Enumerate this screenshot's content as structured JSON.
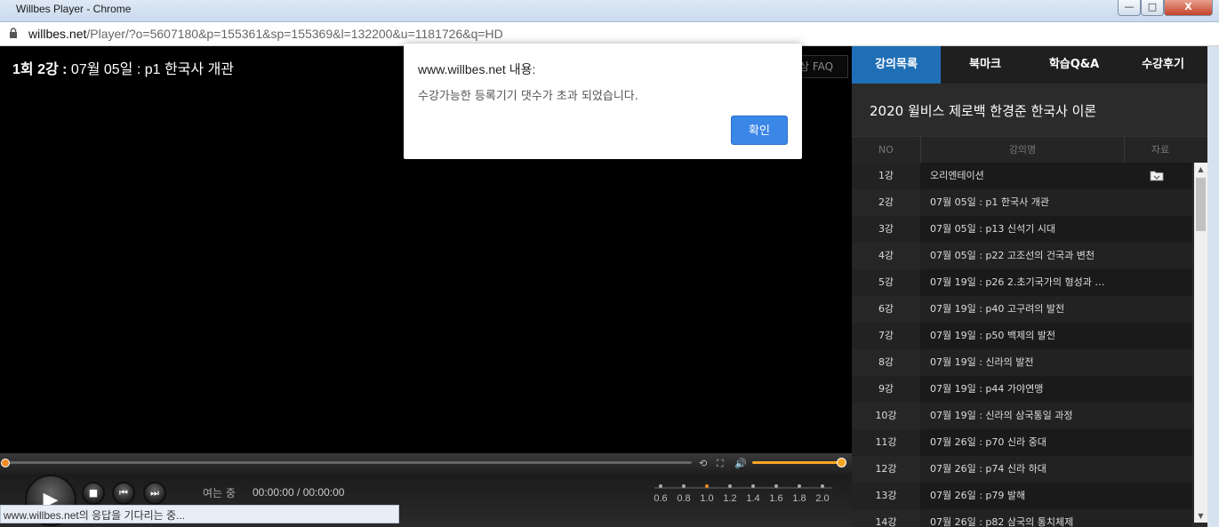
{
  "window": {
    "title": "Willbes Player - Chrome",
    "min_label": "—",
    "max_label": "□",
    "close_label": "X"
  },
  "address": {
    "host": "willbes.net",
    "path": "/Player/?o=5607180&p=155361&sp=155369&l=132200&u=1181726&q=HD"
  },
  "player": {
    "lecture_title_bold": "1회 2강 :",
    "lecture_title_rest": " 07월 05일 : p1 한국사 개관",
    "faq_label": "상 FAQ",
    "loading_text": "여는 중",
    "time_text": "00:00:00 / 00:00:00",
    "speeds": [
      "0.6",
      "0.8",
      "1.0",
      "1.2",
      "1.4",
      "1.6",
      "1.8",
      "2.0"
    ],
    "current_speed_index": 2,
    "seek_progress": 0,
    "volume_level": 1.0
  },
  "status": {
    "text": "www.willbes.net의 응답을 기다리는 중..."
  },
  "side": {
    "tabs": [
      {
        "label": "강의목록"
      },
      {
        "label": "북마크"
      },
      {
        "label": "학습Q&A"
      },
      {
        "label": "수강후기"
      }
    ],
    "course_title": "2020 윌비스 제로백 한경준 한국사 이론",
    "headers": {
      "no": "NO",
      "name": "강의명",
      "file": "자료"
    },
    "rows": [
      {
        "no": "1강",
        "name": "오리엔테이션"
      },
      {
        "no": "2강",
        "name": "07월 05일 : p1 한국사 개관"
      },
      {
        "no": "3강",
        "name": "07월 05일 : p13 신석기 시대"
      },
      {
        "no": "4강",
        "name": "07월 05일 : p22 고조선의 건국과 변천"
      },
      {
        "no": "5강",
        "name": "07월 19일 : p26 2.초기국가의 형성과 …"
      },
      {
        "no": "6강",
        "name": "07월 19일 : p40 고구려의 발전"
      },
      {
        "no": "7강",
        "name": "07월 19일 : p50 백제의 발전"
      },
      {
        "no": "8강",
        "name": "07월 19일 : 신라의 발전"
      },
      {
        "no": "9강",
        "name": "07월 19일 : p44 가야연맹"
      },
      {
        "no": "10강",
        "name": "07월 19일 : 신라의 삼국통일 과정"
      },
      {
        "no": "11강",
        "name": "07월 26일 : p70 신라 중대"
      },
      {
        "no": "12강",
        "name": "07월 26일 : p74 신라 하대"
      },
      {
        "no": "13강",
        "name": "07월 26일 : p79 발해"
      },
      {
        "no": "14강",
        "name": "07월 26일 : p82 삼국의 통치체제"
      }
    ]
  },
  "dialog": {
    "title": "www.willbes.net 내용:",
    "message": "수강가능한 등록기기 댓수가 초과 되었습니다.",
    "ok_label": "확인"
  },
  "colors": {
    "accent": "#1f6fb6",
    "button": "#3b87e8",
    "progress": "#f08a24"
  }
}
